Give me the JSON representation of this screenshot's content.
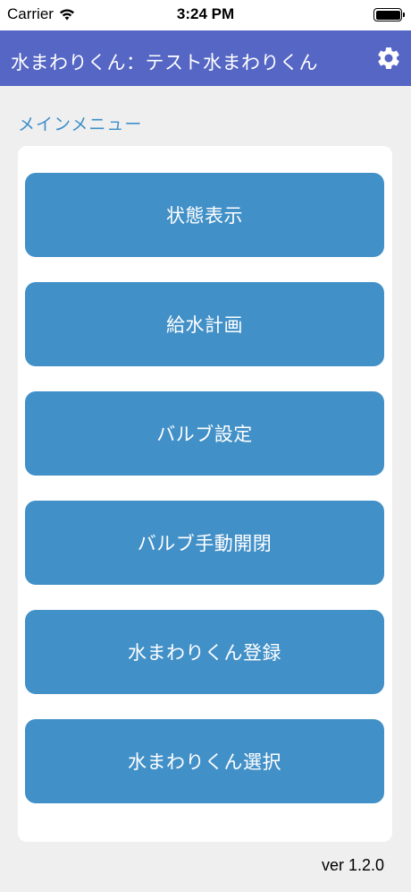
{
  "status_bar": {
    "carrier": "Carrier",
    "time": "3:24 PM",
    "wifi_icon": "wifi-icon",
    "battery_icon": "battery-icon"
  },
  "nav": {
    "title": "水まわりくん：テスト水まわりくん",
    "settings_icon": "gear-icon",
    "background_color": "#5566c4"
  },
  "main": {
    "section_title": "メインメニュー",
    "buttons": [
      {
        "label": "状態表示"
      },
      {
        "label": "給水計画"
      },
      {
        "label": "バルブ設定"
      },
      {
        "label": "バルブ手動開閉"
      },
      {
        "label": "水まわりくん登録"
      },
      {
        "label": "水まわりくん選択"
      }
    ],
    "button_color": "#4290c8"
  },
  "footer": {
    "version": "ver 1.2.0"
  }
}
